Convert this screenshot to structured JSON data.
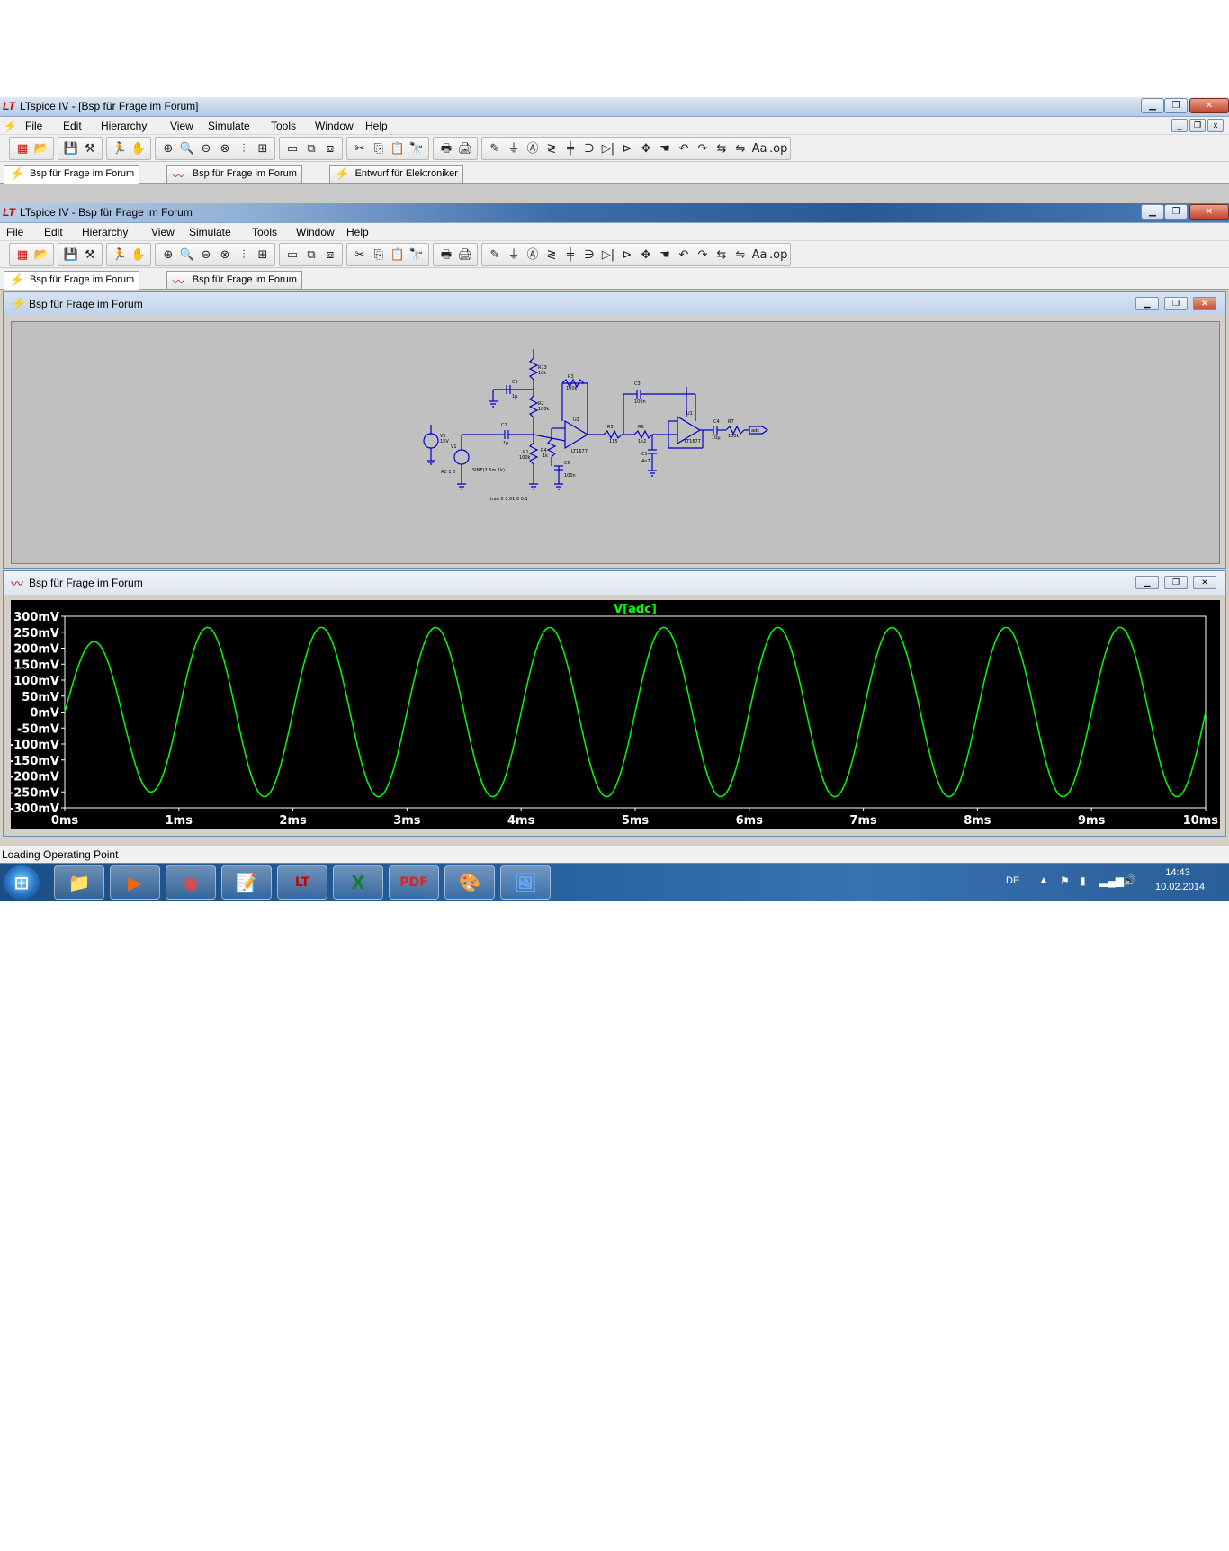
{
  "outer_window": {
    "title": "LTspice IV - [Bsp für Frage im Forum]",
    "menu": [
      "File",
      "Edit",
      "Hierarchy",
      "View",
      "Simulate",
      "Tools",
      "Window",
      "Help"
    ],
    "tabs": [
      {
        "label": "Bsp für Frage im Forum",
        "icon": "schematic-icon"
      },
      {
        "label": "Bsp für Frage im Forum",
        "icon": "waveform-icon"
      },
      {
        "label": "Entwurf für Elektroniker",
        "icon": "schematic-icon"
      }
    ]
  },
  "inner_window": {
    "title": "LTspice IV - Bsp für Frage im Forum",
    "menu": [
      "File",
      "Edit",
      "Hierarchy",
      "View",
      "Simulate",
      "Tools",
      "Window",
      "Help"
    ],
    "tabs": [
      {
        "label": "Bsp für Frage im Forum",
        "icon": "schematic-icon"
      },
      {
        "label": "Bsp für Frage im Forum",
        "icon": "waveform-icon"
      }
    ]
  },
  "toolbar": {
    "icons": [
      "new-schematic-icon",
      "open-icon",
      "save-icon",
      "control-panel-icon",
      "run-icon",
      "halt-icon",
      "zoom-in-icon",
      "zoom-area-icon",
      "zoom-out-icon",
      "zoom-fit-icon",
      "autorange-icon",
      "grid-icon",
      "tile-horizontal-icon",
      "cascade-icon",
      "tile-vertical-icon",
      "cut-icon",
      "copy-icon",
      "paste-icon",
      "find-icon",
      "print-setup-icon",
      "print-icon",
      "wire-icon",
      "ground-icon",
      "label-net-icon",
      "resistor-icon",
      "capacitor-icon",
      "inductor-icon",
      "diode-icon",
      "component-icon",
      "move-icon",
      "drag-icon",
      "undo-icon",
      "redo-icon",
      "rotate-icon",
      "mirror-icon",
      "text-icon",
      "spice-directive-icon"
    ],
    "glyphs": [
      "▦",
      "📂",
      "💾",
      "⚒",
      "🏃",
      "✋",
      "⊕",
      "🔍",
      "⊖",
      "⊗",
      "⫶",
      "⊞",
      "▭",
      "⧉",
      "⧈",
      "✂",
      "⎘",
      "📋",
      "🔭",
      "🖶",
      "🖨",
      "✎",
      "⏚",
      "Ⓐ",
      "≷",
      "╪",
      "∋",
      "▷|",
      "⊳",
      "✥",
      "☚",
      "↶",
      "↷",
      "⇆",
      "⇋",
      "Aa",
      ".op"
    ]
  },
  "schematic_window": {
    "title": "Bsp für Frage im Forum",
    "labels": {
      "v2": "V2",
      "v2val": "15V",
      "v1": "V1",
      "v1ac": "AC 1 0",
      "v1sine": "SINE(2.5m 1k)",
      "r1": "R1",
      "r1val": "100k",
      "r2": "R2",
      "r2val": "100k",
      "r3": "R3",
      "r3val": "100k",
      "r4": "R4",
      "r4val": "1k",
      "r5": "R5",
      "r5val": "115",
      "r6": "R6",
      "r6val": "1k2",
      "r7": "R7",
      "r7val": "100k",
      "r13": "R13",
      "r13val": "10k",
      "c1": "C1",
      "c1val": "4n7",
      "c2": "C2",
      "c2val": "1µ",
      "c3": "C3",
      "c3val": "100n",
      "c4": "C4",
      "c4val": "10µ",
      "c5": "C5",
      "c5val": "1µ",
      "c6": "C6",
      "c6val": "100n",
      "u1": "U1",
      "u1part": "LT1677",
      "u2": "U2",
      "u2part": "LT1677",
      "net": "adc",
      "directive": ".tran 0 0.01 0 0.1"
    }
  },
  "plot_window": {
    "title": "Bsp für Frage im Forum",
    "chart_data": {
      "type": "line",
      "series": [
        {
          "name": "V[adc]",
          "color": "#00ff00",
          "description_x_unit": "ms",
          "amplitude_mV": 265,
          "frequency_kHz": 1
        }
      ],
      "title": "V[adc]",
      "yticks": [
        "300mV",
        "250mV",
        "200mV",
        "150mV",
        "100mV",
        "50mV",
        "0mV",
        "-50mV",
        "-100mV",
        "-150mV",
        "-200mV",
        "-250mV",
        "-300mV"
      ],
      "xticks": [
        "0ms",
        "1ms",
        "2ms",
        "3ms",
        "4ms",
        "5ms",
        "6ms",
        "7ms",
        "8ms",
        "9ms",
        "10ms"
      ],
      "xlim": [
        0,
        10
      ],
      "ylim": [
        -300,
        300
      ],
      "x": [
        0,
        0.25,
        0.5,
        0.75,
        1,
        1.25,
        1.5,
        1.75,
        2,
        2.25,
        2.5,
        2.75,
        3,
        3.25,
        3.5,
        3.75,
        4,
        4.25,
        4.5,
        4.75,
        5,
        5.25,
        5.5,
        5.75,
        6,
        6.25,
        6.5,
        6.75,
        7,
        7.25,
        7.5,
        7.75,
        8,
        8.25,
        8.5,
        8.75,
        9,
        9.25,
        9.5,
        9.75,
        10
      ],
      "y": [
        0,
        205,
        20,
        -220,
        0,
        265,
        0,
        -265,
        0,
        265,
        0,
        -265,
        0,
        265,
        0,
        -265,
        0,
        265,
        0,
        -265,
        0,
        265,
        0,
        -265,
        0,
        265,
        0,
        -265,
        0,
        265,
        0,
        -265,
        0,
        265,
        0,
        -265,
        0,
        265,
        0,
        -265,
        0
      ],
      "grid": false,
      "colors": {
        "background": "#000000",
        "trace": "#00ff00",
        "axis": "#ffffff"
      }
    }
  },
  "status_bar": {
    "text": "Loading Operating Point"
  },
  "taskbar": {
    "apps": [
      "explorer-icon",
      "media-player-icon",
      "chrome-icon",
      "notepad-icon",
      "ltspice-icon",
      "excel-icon",
      "pdf-icon",
      "paint-icon",
      "photo-viewer-icon"
    ],
    "glyphs": [
      "📁",
      "▶",
      "◉",
      "📝",
      "LT",
      "X",
      "PDF",
      "🎨",
      "🖼"
    ],
    "language": "DE",
    "time": "14:43",
    "date": "10.02.2014"
  }
}
